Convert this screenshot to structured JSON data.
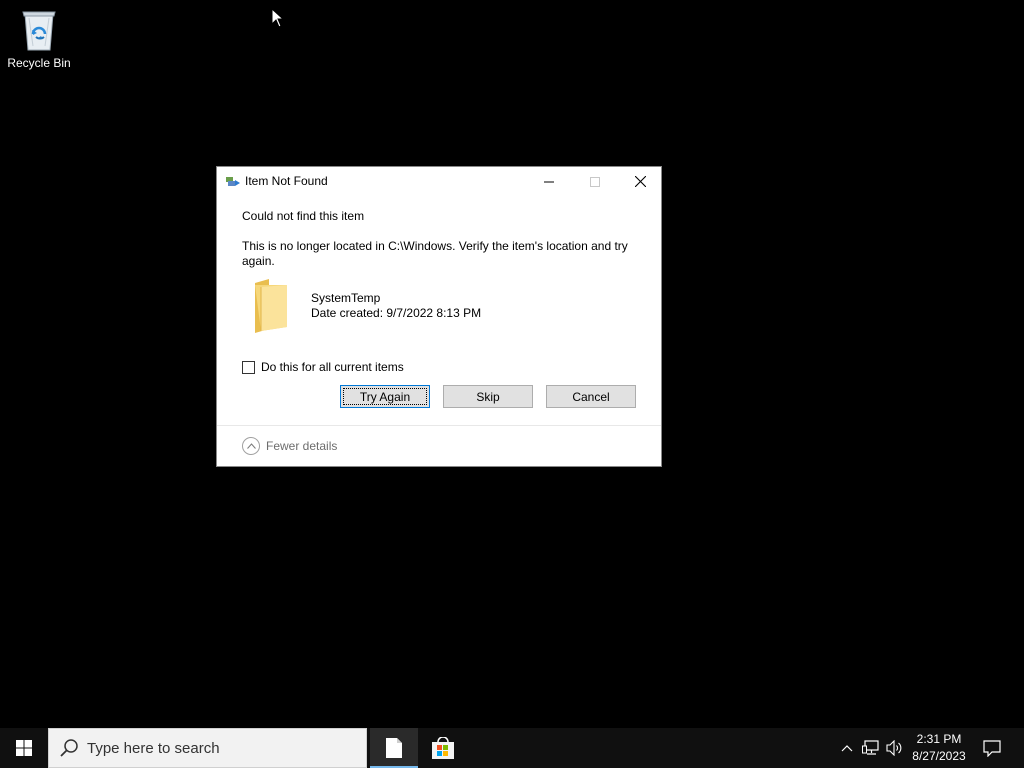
{
  "desktop": {
    "icons": [
      {
        "label": "Recycle Bin",
        "icon": "recycle-bin-icon"
      }
    ]
  },
  "dialog": {
    "title": "Item Not Found",
    "heading": "Could not find this item",
    "message": "This is no longer located in C:\\Windows. Verify the item's location and try again.",
    "item": {
      "name": "SystemTemp",
      "date_created": "Date created: 9/7/2022 8:13 PM",
      "icon": "folder-icon"
    },
    "checkbox_label": "Do this for all current items",
    "checkbox_checked": false,
    "buttons": {
      "try_again": "Try Again",
      "skip": "Skip",
      "cancel": "Cancel"
    },
    "details_label": "Fewer details"
  },
  "taskbar": {
    "search_placeholder": "Type here to search",
    "clock": {
      "time": "2:31 PM",
      "date": "8/27/2023"
    }
  },
  "colors": {
    "desktop_background": "#000000",
    "taskbar_background": "#101010",
    "button_focus_border": "#0078d7",
    "folder_yellow": "#f6d77a"
  }
}
